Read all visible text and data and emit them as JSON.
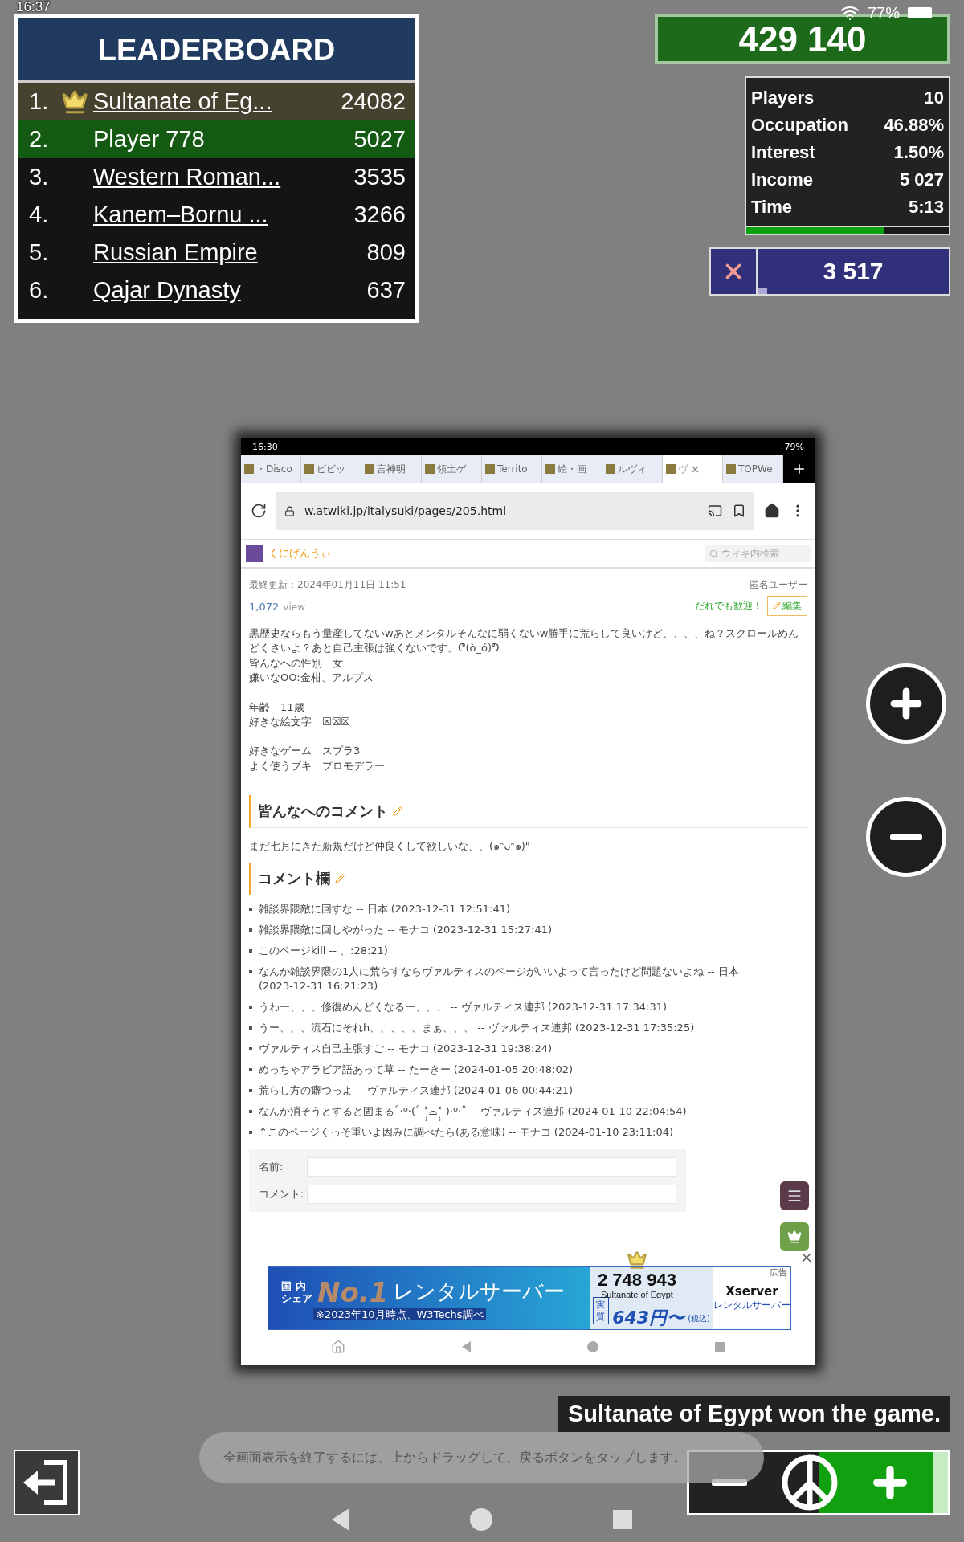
{
  "status_bar": {
    "time": "16:37",
    "battery": "77%"
  },
  "leaderboard": {
    "title": "LEADERBOARD",
    "rows": [
      {
        "rank": "1.",
        "name": "Sultanate of Eg...",
        "score": "24082",
        "crown": true,
        "selected": false
      },
      {
        "rank": "2.",
        "name": "Player 778",
        "score": "5027",
        "crown": false,
        "selected": true
      },
      {
        "rank": "3.",
        "name": "Western Roman...",
        "score": "3535",
        "crown": false,
        "selected": false
      },
      {
        "rank": "4.",
        "name": "Kanem–Bornu ...",
        "score": "3266",
        "crown": false,
        "selected": false
      },
      {
        "rank": "5.",
        "name": "Russian Empire",
        "score": "809",
        "crown": false,
        "selected": false
      },
      {
        "rank": "6.",
        "name": "Qajar Dynasty",
        "score": "637",
        "crown": false,
        "selected": false
      }
    ]
  },
  "balance": "429 140",
  "stats": {
    "rows": [
      {
        "label": "Players",
        "value": "10"
      },
      {
        "label": "Occupation",
        "value": "46.88%"
      },
      {
        "label": "Interest",
        "value": "1.50%"
      },
      {
        "label": "Income",
        "value": "5 027"
      },
      {
        "label": "Time",
        "value": "5:13"
      }
    ],
    "level": 0.68
  },
  "attack": {
    "value": "3 517",
    "level": 0.05
  },
  "map_image": {
    "status_bar": {
      "time": "16:30",
      "battery": "79%"
    },
    "tabs": [
      {
        "label": "・Disco",
        "selected": false
      },
      {
        "label": "ビビッ",
        "selected": false
      },
      {
        "label": "言神明",
        "selected": false
      },
      {
        "label": "領土ゲ",
        "selected": false
      },
      {
        "label": "Territo",
        "selected": false
      },
      {
        "label": "絵・画",
        "selected": false
      },
      {
        "label": "ルヴィ",
        "selected": false
      },
      {
        "label": "ヴ",
        "selected": true
      },
      {
        "label": "TOPWe",
        "selected": false
      }
    ],
    "url": "w.atwiki.jp/italysuki/pages/205.html",
    "site_name": "くにげんうぃ",
    "search_placeholder": "ウィキ内検索",
    "updated": "最終更新：2024年01月11日 11:51",
    "author": "匿名ユーザー",
    "views": "1,072",
    "views_unit": "view",
    "welcome": "だれでも歓迎！",
    "edit": "編集",
    "intro": [
      "黒歴史ならもう量産してないwあとメンタルそんなに弱くないw勝手に荒らして良いけど、、、、ね？スクロールめんどくさいよ？あと自己主張は強くないです。ᕦ(ò_ó)ᕤ",
      "皆んなへの性別　女",
      "嫌いなOO:金柑、アルプス",
      "年齢　11歳",
      "好きな絵文字　☒☒☒",
      "好きなゲーム　スプラ3",
      "よく使うブキ　プロモデラー"
    ],
    "section_heading": "皆んなへのコメント",
    "section_text": "まだ七月にきた新規だけど仲良くして欲しいな、、(๑ᵔᴗᵔ๑)\"",
    "comments_heading": "コメント欄",
    "comments": [
      "雑談界隈敵に回すな -- 日本 (2023-12-31 12:51:41)",
      "雑談界隈敵に回しやがった -- モナコ (2023-12-31 15:27:41)",
      "このページkill -- 、:28:21)",
      "なんか雑談界隈の1人に荒らすならヴァルティスのページがいいよって言ったけど問題ないよね -- 日本 (2023-12-31 16:21:23)",
      "うわー、、、修復めんどくなるー、、、 -- ヴァルティス連邦 (2023-12-31 17:34:31)",
      "うー、、、流石にそれh、、、、、まぁ、、、 -- ヴァルティス連邦 (2023-12-31 17:35:25)",
      "ヴァルティス自己主張すご -- モナコ (2023-12-31 19:38:24)",
      "めっちゃアラビア語あって草 -- たーきー (2024-01-05 20:48:02)",
      "荒らし方の癖つっよ -- ヴァルティス連邦 (2024-01-06 00:44:21)",
      "なんか消そうとすると固まる˚‧º·(˚ ˃̣̣̥⌓˂̣̣̥ )‧º·˚ -- ヴァルティス連邦 (2024-01-10 22:04:54)",
      "↑このページくっそ重いよ因みに調べたら(ある意味) -- モナコ (2024-01-10 23:11:04)"
    ],
    "form_labels": [
      "名前:",
      "コメント:"
    ],
    "ad": {
      "share_lines": [
        "国 内",
        "シェア"
      ],
      "rank": "No.1",
      "product": "レンタルサーバー",
      "footnote": "※2023年10月時点、W3Techs調べ",
      "price_tag": "実質",
      "price": "643円〜",
      "tax": "(税込)",
      "brand": "Xserver",
      "brand_sub": "レンタルサーバー",
      "label": "広告"
    }
  },
  "map_label": {
    "value": "2 748 943",
    "name": "Sultanate of Egypt"
  },
  "message": "Sultanate of Egypt won the game.",
  "toast": "全画面表示を終了するには、上からドラッグして、戻るボタンをタップします。"
}
